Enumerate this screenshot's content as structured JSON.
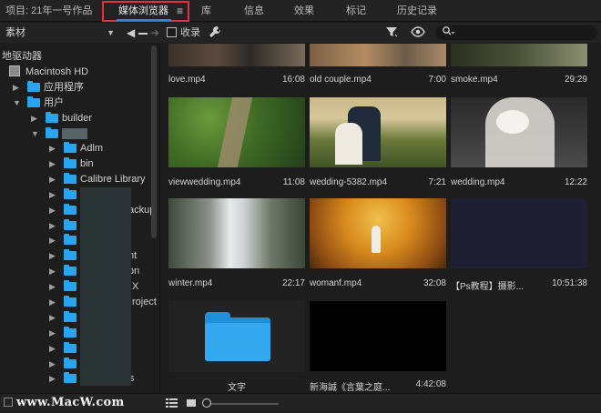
{
  "tabs": {
    "project": "项目: 21年一号作品",
    "media_browser": "媒体浏览器",
    "menu_glyph": "≡",
    "library": "库",
    "info": "信息",
    "effects": "效果",
    "markers": "标记",
    "history": "历史记录"
  },
  "toolbar": {
    "location": "素材",
    "collect_label": "收录"
  },
  "tree": {
    "local_drives": "地驱动器",
    "macintosh_hd": "Macintosh HD",
    "applications": "应用程序",
    "users": "用户",
    "builder": "builder",
    "items": [
      "Adlm",
      "bin",
      "Calibre Library",
      "ackup",
      "nt",
      "on",
      "X",
      "roject",
      "s"
    ]
  },
  "grid": {
    "row1": [
      {
        "name": "love.mp4",
        "duration": "16:08"
      },
      {
        "name": "old couple.mp4",
        "duration": "7:00"
      },
      {
        "name": "smoke.mp4",
        "duration": "29:29"
      }
    ],
    "row2": [
      {
        "name": "viewwedding.mp4",
        "duration": "11:08"
      },
      {
        "name": "wedding-5382.mp4",
        "duration": "7:21"
      },
      {
        "name": "wedding.mp4",
        "duration": "12:22"
      }
    ],
    "row3": [
      {
        "name": "winter.mp4",
        "duration": "22:17"
      },
      {
        "name": "womanf.mp4",
        "duration": "32:08"
      },
      {
        "name": "【Ps教程】摄影...",
        "duration": "10:51:38"
      }
    ],
    "row4": [
      {
        "name": "文字",
        "duration": ""
      },
      {
        "name": "新海誠《言葉之庭...",
        "duration": "4:42:08"
      }
    ]
  },
  "watermark": "www.MacW.com",
  "colors": {
    "accent_blue": "#2f87e6",
    "folder_blue": "#29a4ef",
    "highlight_red": "#e0333a"
  }
}
